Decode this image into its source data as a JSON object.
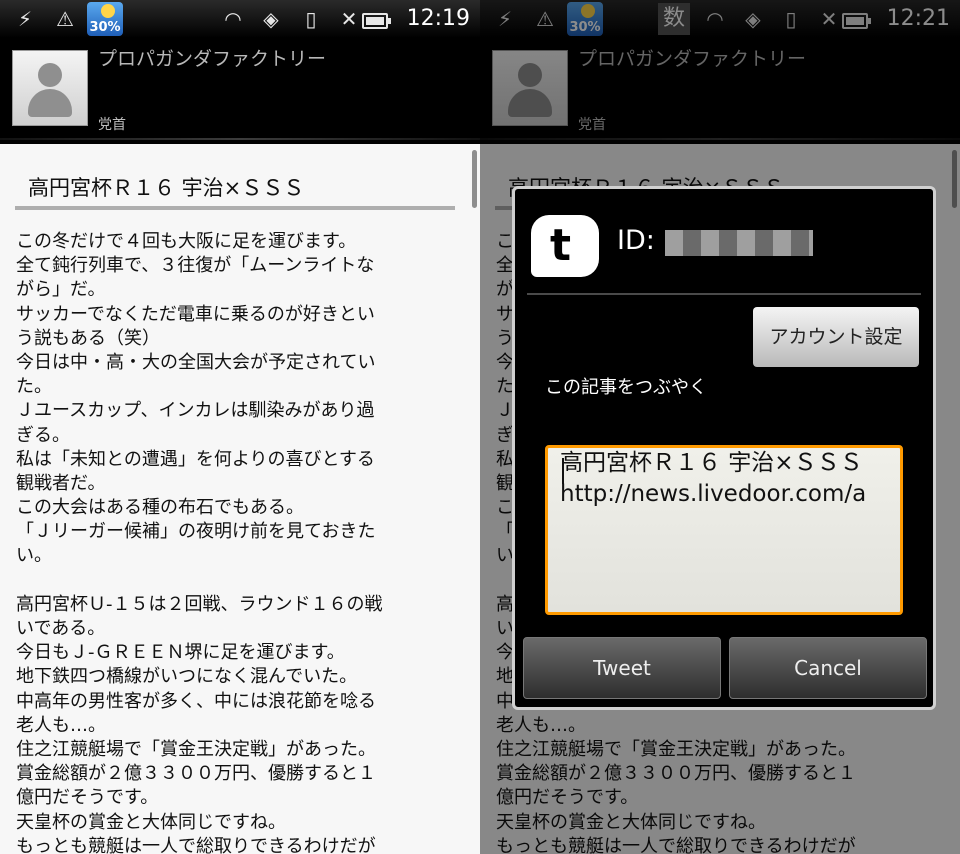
{
  "left_screen": {
    "status": {
      "weather_temp": "30%",
      "time": "12:19"
    }
  },
  "right_screen": {
    "status": {
      "input_mode": "数",
      "weather_temp": "30%",
      "time": "12:21"
    }
  },
  "header": {
    "blog_name": "プロパガンダファクトリー",
    "author": "党首"
  },
  "article": {
    "title": "高円宮杯Ｒ１６ 宇治×ＳＳＳ",
    "lines": [
      "この冬だけで４回も大阪に足を運びます。",
      "全て鈍行列車で、３往復が「ムーンライトな",
      "がら」だ。",
      "サッカーでなくただ電車に乗るのが好きとい",
      "う説もある（笑）",
      "今日は中・高・大の全国大会が予定されてい",
      "た。",
      "Ｊユースカップ、インカレは馴染みがあり過",
      "ぎる。",
      "私は「未知との遭遇」を何よりの喜びとする",
      "観戦者だ。",
      "この大会はある種の布石でもある。",
      "「Ｊリーガー候補」の夜明け前を見ておきた",
      "い。",
      "",
      "高円宮杯Ｕ-１５は２回戦、ラウンド１６の戦",
      "いである。",
      "今日もＪ-ＧＲＥＥＮ堺に足を運びます。",
      "地下鉄四つ橋線がいつになく混んでいた。",
      "中高年の男性客が多く、中には浪花節を唸る",
      "老人も…。",
      "住之江競艇場で「賞金王決定戦」があった。",
      "賞金総額が２億３３００万円、優勝すると１",
      "億円だそうです。",
      "天皇杯の賞金と大体同じですね。",
      "もっとも競艇は一人で総取りできるわけだが"
    ]
  },
  "dialog": {
    "id_label": "ID:",
    "account_button": "アカウント設定",
    "prompt": "この記事をつぶやく",
    "tweet_lines": [
      "高円宮杯Ｒ１６ 宇治×ＳＳＳ",
      "http://news.livedoor.com/a"
    ],
    "tweet_button": "Tweet",
    "cancel_button": "Cancel"
  },
  "colors": {
    "focus_border": "#ff9a00",
    "article_bg": "#f7f7f7"
  },
  "icons": [
    "usb-icon",
    "warning-icon",
    "weather-icon",
    "wifi-icon",
    "sync-icon",
    "no-sim-icon",
    "no-signal-icon",
    "battery-icon",
    "twitter-icon"
  ]
}
